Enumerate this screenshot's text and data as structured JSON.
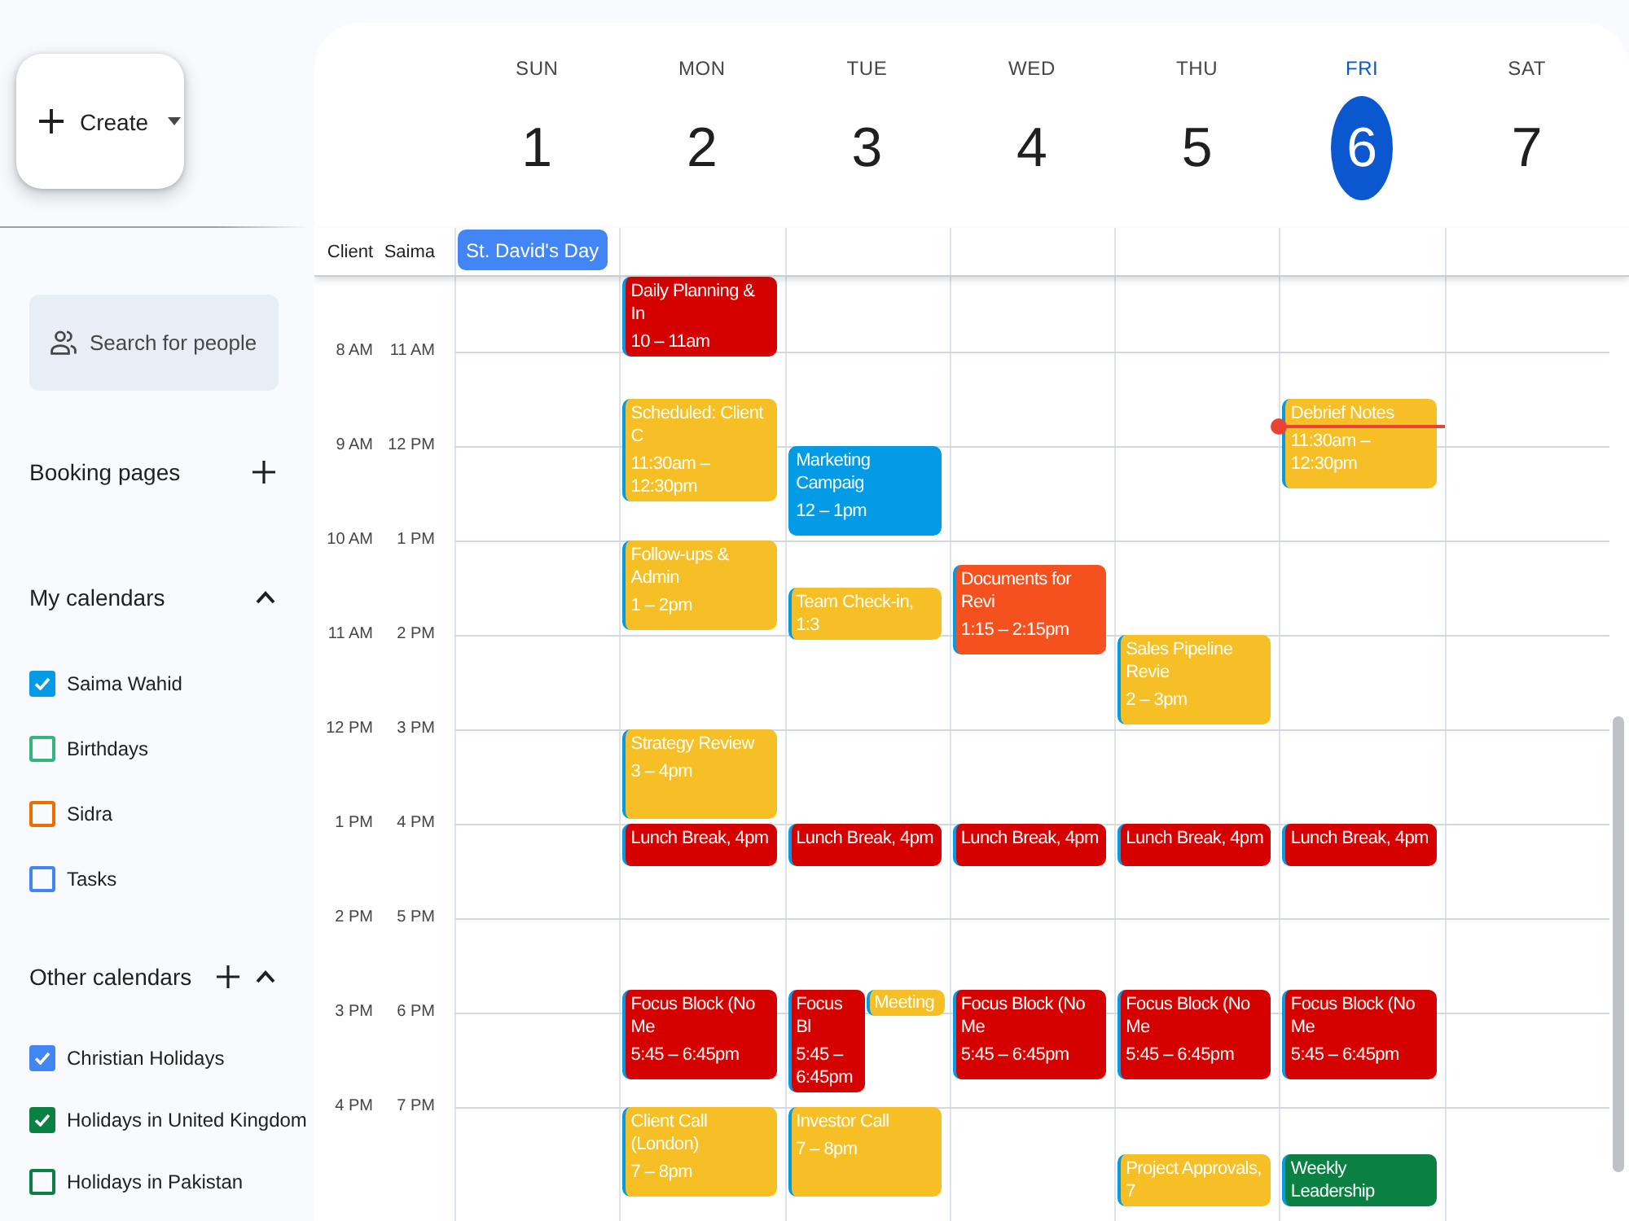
{
  "sidebar": {
    "create_button": {
      "label": "Create"
    },
    "search": {
      "placeholder": "Search for people"
    },
    "booking_pages": {
      "title": "Booking pages"
    },
    "my_calendars": {
      "title": "My calendars",
      "expanded": true,
      "items": [
        {
          "label": "Saima Wahid",
          "checked": true,
          "color": "#039be5"
        },
        {
          "label": "Birthdays",
          "checked": false,
          "color": "#33b679"
        },
        {
          "label": "Sidra",
          "checked": false,
          "color": "#ef6c00"
        },
        {
          "label": "Tasks",
          "checked": false,
          "color": "#4285f4"
        }
      ]
    },
    "other_calendars": {
      "title": "Other calendars",
      "expanded": true,
      "items": [
        {
          "label": "Christian Holidays",
          "checked": true,
          "color": "#4285f4"
        },
        {
          "label": "Holidays in United Kingdom",
          "checked": true,
          "color": "#0b8043"
        },
        {
          "label": "Holidays in Pakistan",
          "checked": false,
          "color": "#0b8043"
        }
      ]
    }
  },
  "calendar": {
    "timezones": [
      {
        "label": "Client"
      },
      {
        "label": "Saima"
      }
    ],
    "days": [
      {
        "name": "SUN",
        "date": "1",
        "selected": false,
        "all_day": [
          {
            "title": "St. David's Day"
          }
        ]
      },
      {
        "name": "MON",
        "date": "2",
        "selected": false,
        "events": [
          {
            "title": "Daily Planning & In",
            "time": "10 – 11am",
            "color": "#d50000"
          },
          {
            "title": "Scheduled: Client C",
            "time": "11:30am – 12:30pm",
            "color": "#f6bf26"
          },
          {
            "title": "Follow-ups & Admin",
            "time": "1 – 2pm",
            "color": "#f6bf26"
          },
          {
            "title": "Strategy Review",
            "time": "3 – 4pm",
            "color": "#f6bf26"
          },
          {
            "title": "Lunch Break, 4pm",
            "color": "#d50000"
          },
          {
            "title": "Focus Block (No Me",
            "time": "5:45 – 6:45pm",
            "color": "#d50000"
          },
          {
            "title": "Client Call (London)",
            "time": "7 – 8pm",
            "color": "#f6bf26"
          }
        ]
      },
      {
        "name": "TUE",
        "date": "3",
        "selected": false,
        "events": [
          {
            "title": "Marketing Campaig",
            "time": "12 – 1pm",
            "color": "#039be5"
          },
          {
            "title": "Team Check-in, 1:3",
            "color": "#f6bf26"
          },
          {
            "title": "Lunch Break, 4pm",
            "color": "#d50000"
          },
          {
            "title": "Focus Bl",
            "time": "5:45 – 6:45pm",
            "color": "#d50000"
          },
          {
            "title": "Meeting",
            "color": "#f6bf26"
          },
          {
            "title": "Investor Call",
            "time": "7 – 8pm",
            "color": "#f6bf26"
          }
        ]
      },
      {
        "name": "WED",
        "date": "4",
        "selected": false,
        "events": [
          {
            "title": "Documents for Revi",
            "time": "1:15 – 2:15pm",
            "color": "#f4511e"
          },
          {
            "title": "Lunch Break, 4pm",
            "color": "#d50000"
          },
          {
            "title": "Focus Block (No Me",
            "time": "5:45 – 6:45pm",
            "color": "#d50000"
          }
        ]
      },
      {
        "name": "THU",
        "date": "5",
        "selected": false,
        "events": [
          {
            "title": "Sales Pipeline Revie",
            "time": "2 – 3pm",
            "color": "#f6bf26"
          },
          {
            "title": "Lunch Break, 4pm",
            "color": "#d50000"
          },
          {
            "title": "Focus Block (No Me",
            "time": "5:45 – 6:45pm",
            "color": "#d50000"
          },
          {
            "title": "Project Approvals, 7",
            "color": "#f6bf26"
          }
        ]
      },
      {
        "name": "FRI",
        "date": "6",
        "selected": true,
        "events": [
          {
            "title": "Debrief Notes",
            "time": "11:30am – 12:30pm",
            "color": "#f6bf26"
          },
          {
            "title": "Lunch Break, 4pm",
            "color": "#d50000"
          },
          {
            "title": "Focus Block (No Me",
            "time": "5:45 – 6:45pm",
            "color": "#d50000"
          },
          {
            "title": "Weekly Leadership",
            "color": "#0b8043"
          }
        ]
      },
      {
        "name": "SAT",
        "date": "7",
        "selected": false
      }
    ],
    "hours": [
      [
        "8 AM",
        "11 AM"
      ],
      [
        "9 AM",
        "12 PM"
      ],
      [
        "10 AM",
        "1 PM"
      ],
      [
        "11 AM",
        "2 PM"
      ],
      [
        "12 PM",
        "3 PM"
      ],
      [
        "1 PM",
        "4 PM"
      ],
      [
        "2 PM",
        "5 PM"
      ],
      [
        "3 PM",
        "6 PM"
      ],
      [
        "4 PM",
        "7 PM"
      ]
    ]
  }
}
